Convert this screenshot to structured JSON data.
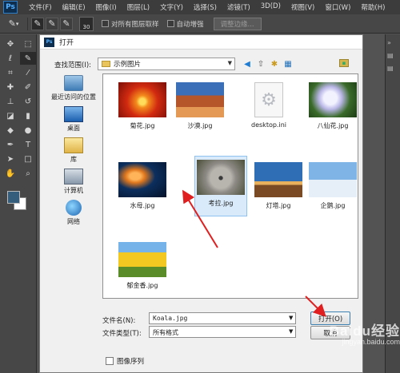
{
  "app": {
    "logo": "Ps",
    "menu": [
      "文件(F)",
      "编辑(E)",
      "图像(I)",
      "图层(L)",
      "文字(Y)",
      "选择(S)",
      "滤镜(T)",
      "3D(D)",
      "视图(V)",
      "窗口(W)",
      "帮助(H)"
    ]
  },
  "options_bar": {
    "brush_size": "30",
    "sample_all_layers": "对所有图层取样",
    "auto_enhance": "自动增强",
    "refine_edge": "调整边缘..."
  },
  "swatches": {
    "foreground": "#355d7c",
    "background": "#ffffff"
  },
  "dialog": {
    "title": "打开",
    "look_in_label": "查找范围(I):",
    "look_in_value": "示例图片",
    "places": [
      {
        "label": "最近访问的位置",
        "icon": "recent-places-icon"
      },
      {
        "label": "桌面",
        "icon": "desktop-icon"
      },
      {
        "label": "库",
        "icon": "library-icon"
      },
      {
        "label": "计算机",
        "icon": "computer-icon"
      },
      {
        "label": "网络",
        "icon": "network-icon"
      }
    ],
    "files": [
      {
        "name": "菊花.jpg",
        "selected": false
      },
      {
        "name": "沙漠.jpg",
        "selected": false
      },
      {
        "name": "desktop.ini",
        "selected": false
      },
      {
        "name": "八仙花.jpg",
        "selected": false
      },
      {
        "name": "水母.jpg",
        "selected": false
      },
      {
        "name": "考拉.jpg",
        "selected": true
      },
      {
        "name": "灯塔.jpg",
        "selected": false
      },
      {
        "name": "企鹅.jpg",
        "selected": false
      },
      {
        "name": "郁金香.jpg",
        "selected": false
      }
    ],
    "file_name_label": "文件名(N):",
    "file_name_value": "Koala.jpg",
    "file_type_label": "文件类型(T):",
    "file_type_value": "所有格式",
    "open_button": "打开(O)",
    "cancel_button": "取消",
    "image_sequence": "图像序列"
  },
  "annotation": {
    "arrow_color": "#e02020"
  },
  "watermark": {
    "text": "Baidu经验",
    "url": "jingyan.baidu.com"
  }
}
